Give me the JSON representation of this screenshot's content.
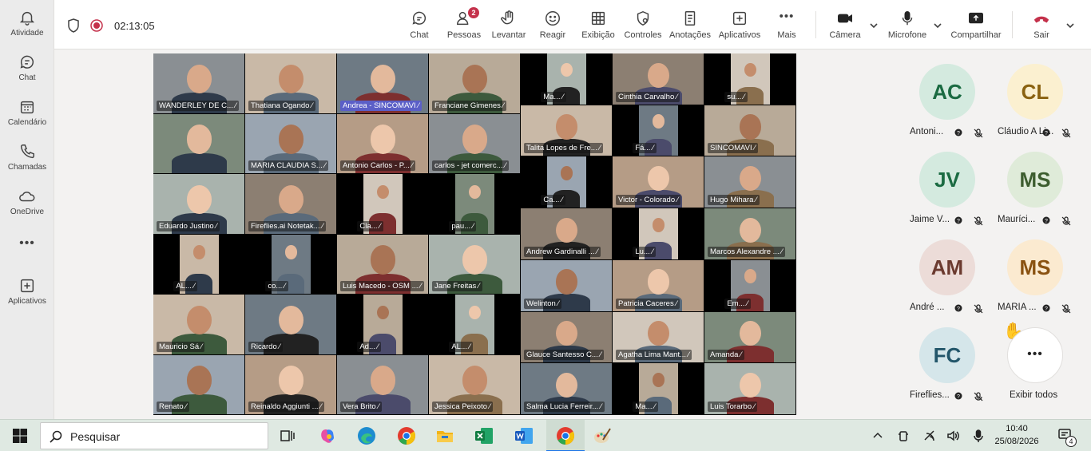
{
  "rail": [
    {
      "label": "Atividade",
      "icon": "bell-icon"
    },
    {
      "label": "Chat",
      "icon": "chat-icon"
    },
    {
      "label": "Calendário",
      "icon": "calendar-icon"
    },
    {
      "label": "Chamadas",
      "icon": "phone-icon"
    },
    {
      "label": "OneDrive",
      "icon": "cloud-icon"
    },
    {
      "label": "",
      "icon": "more-icon"
    },
    {
      "label": "Aplicativos",
      "icon": "add-apps-icon"
    }
  ],
  "topbar": {
    "timer": "02:13:05",
    "people_badge": "2",
    "chat": "Chat",
    "people": "Pessoas",
    "raise": "Levantar",
    "react": "Reagir",
    "view": "Exibição",
    "controls": "Controles",
    "notes": "Anotações",
    "apps": "Aplicativos",
    "more": "Mais",
    "camera": "Câmera",
    "mic": "Microfone",
    "share": "Compartilhar",
    "leave": "Sair",
    "leave_color": "#c4314b"
  },
  "tiles": [
    "WANDERLEY DE C...",
    "Thatiana Ogando",
    "Andrea - SINCOMAVI",
    "Franciane Gimenes",
    "Ma...",
    "Cinthia Carvalho",
    "su...",
    "",
    "MARIA CLAUDIA S...",
    "Antonio Carlos - P...",
    "carlos - jet comerc...",
    "Talita Lopes de Fre...",
    "Fá...",
    "SINCOMAVI",
    "Eduardo Justino",
    "Fireflies.ai Notetak...",
    "Cla...",
    "pau...",
    "Ca...",
    "Victor - Colorado",
    "Hugo Mihara",
    "AL...",
    "co...",
    "Luis Macedo - OSM ...",
    "Jane Freitas",
    "Andrew Gardinalli ...",
    "Lu...",
    "Marcos Alexandre ...",
    "Welinton",
    "Patricia Caceres",
    "Em...",
    "Mauricio Sá",
    "Ricardo",
    "Ad...",
    "AL...",
    "Glauce Santesso C...",
    "Agatha Lima Mant...",
    "Amanda",
    "Renato",
    "Reinaldo Aggiunti ...",
    "Vera Brito",
    "Jessica Peixoto",
    "Salma Lucia Ferreir...",
    "Ma...",
    "Luis Torarbo"
  ],
  "participants": [
    {
      "initials": "AC",
      "name": "Antoni...",
      "bg": "#d4eadf",
      "fg": "#1b6b42"
    },
    {
      "initials": "CL",
      "name": "Cláudio A Li...",
      "bg": "#fbf0d0",
      "fg": "#8a6211"
    },
    {
      "initials": "JV",
      "name": "Jaime V...",
      "bg": "#d4eadf",
      "fg": "#1b6b42"
    },
    {
      "initials": "MS",
      "name": "Mauríci...",
      "bg": "#dfebd9",
      "fg": "#3d5d2f"
    },
    {
      "initials": "AM",
      "name": "André ...",
      "bg": "#ecdcd8",
      "fg": "#6b3a2f"
    },
    {
      "initials": "MS",
      "name": "MARIA ...",
      "bg": "#fbead0",
      "fg": "#8a5211"
    },
    {
      "initials": "FC",
      "name": "Fireflies...",
      "bg": "#d5e6ea",
      "fg": "#23566a"
    }
  ],
  "show_all": "Exibir todos",
  "taskbar": {
    "search_placeholder": "Pesquisar",
    "time": "10:40",
    "date": "25/08/2026",
    "notif_count": "4"
  }
}
